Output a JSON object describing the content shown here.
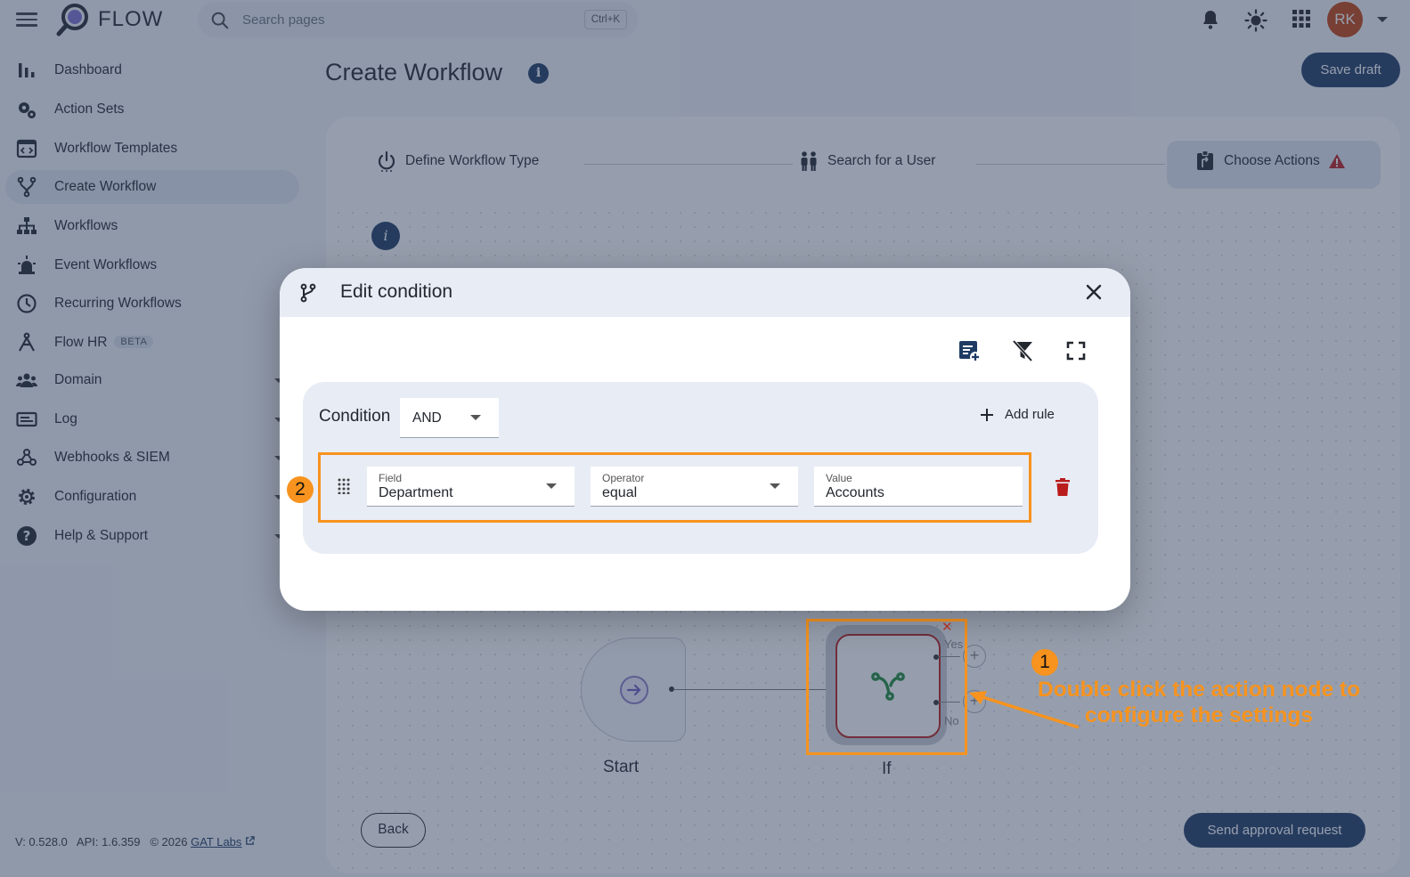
{
  "header": {
    "app_name": "FLOW",
    "search_placeholder": "Search pages",
    "search_shortcut": "Ctrl+K",
    "avatar_initials": "RK"
  },
  "sidebar": {
    "items": [
      {
        "label": "Dashboard",
        "icon": "bar-chart-icon"
      },
      {
        "label": "Action Sets",
        "icon": "gears-icon"
      },
      {
        "label": "Workflow Templates",
        "icon": "template-icon"
      },
      {
        "label": "Create Workflow",
        "icon": "branch-icon",
        "active": true
      },
      {
        "label": "Workflows",
        "icon": "sitemap-icon"
      },
      {
        "label": "Event Workflows",
        "icon": "alarm-light-icon"
      },
      {
        "label": "Recurring Workflows",
        "icon": "clock-icon"
      },
      {
        "label": "Flow HR",
        "icon": "network-icon",
        "badge": "BETA"
      },
      {
        "label": "Domain",
        "icon": "people-group-icon",
        "expandable": true
      },
      {
        "label": "Log",
        "icon": "log-card-icon",
        "expandable": true
      },
      {
        "label": "Webhooks & SIEM",
        "icon": "webhook-icon",
        "expandable": true
      },
      {
        "label": "Configuration",
        "icon": "gear-icon",
        "expandable": true
      },
      {
        "label": "Help & Support",
        "icon": "help-icon",
        "expandable": true
      }
    ],
    "footer": {
      "version": "V: 0.528.0",
      "api": "API: 1.6.359",
      "copyright": "© 2026",
      "company_link": "GAT Labs"
    }
  },
  "main": {
    "title": "Create Workflow",
    "save_draft_label": "Save draft",
    "steps": [
      {
        "label": "Define Workflow Type",
        "icon": "power-icon"
      },
      {
        "label": "Search for a User",
        "icon": "people-icon"
      },
      {
        "label": "Choose Actions",
        "icon": "actions-icon",
        "active": true,
        "warning": true
      }
    ],
    "canvas": {
      "nodes": [
        {
          "label": "Start",
          "icon": "arrow-right-circle-icon"
        },
        {
          "label": "If",
          "icon": "branch-icon"
        }
      ],
      "branch_yes": "Yes",
      "branch_no": "No"
    },
    "back_label": "Back",
    "send_label": "Send approval request"
  },
  "annotations": {
    "step1_number": "1",
    "step1_text_line1": "Double click the action node to",
    "step1_text_line2": "configure the settings",
    "step2_number": "2",
    "highlight_color": "#f7931e"
  },
  "modal": {
    "title": "Edit condition",
    "condition_label": "Condition",
    "combinator": "AND",
    "add_rule_label": "Add rule",
    "rule": {
      "field_label": "Field",
      "field_value": "Department",
      "operator_label": "Operator",
      "operator_value": "equal",
      "value_label": "Value",
      "value_value": "Accounts"
    }
  },
  "colors": {
    "primary": "#1f3b63",
    "accent_orange": "#f7931e",
    "danger": "#b91c1c",
    "avatar": "#c2410c"
  }
}
